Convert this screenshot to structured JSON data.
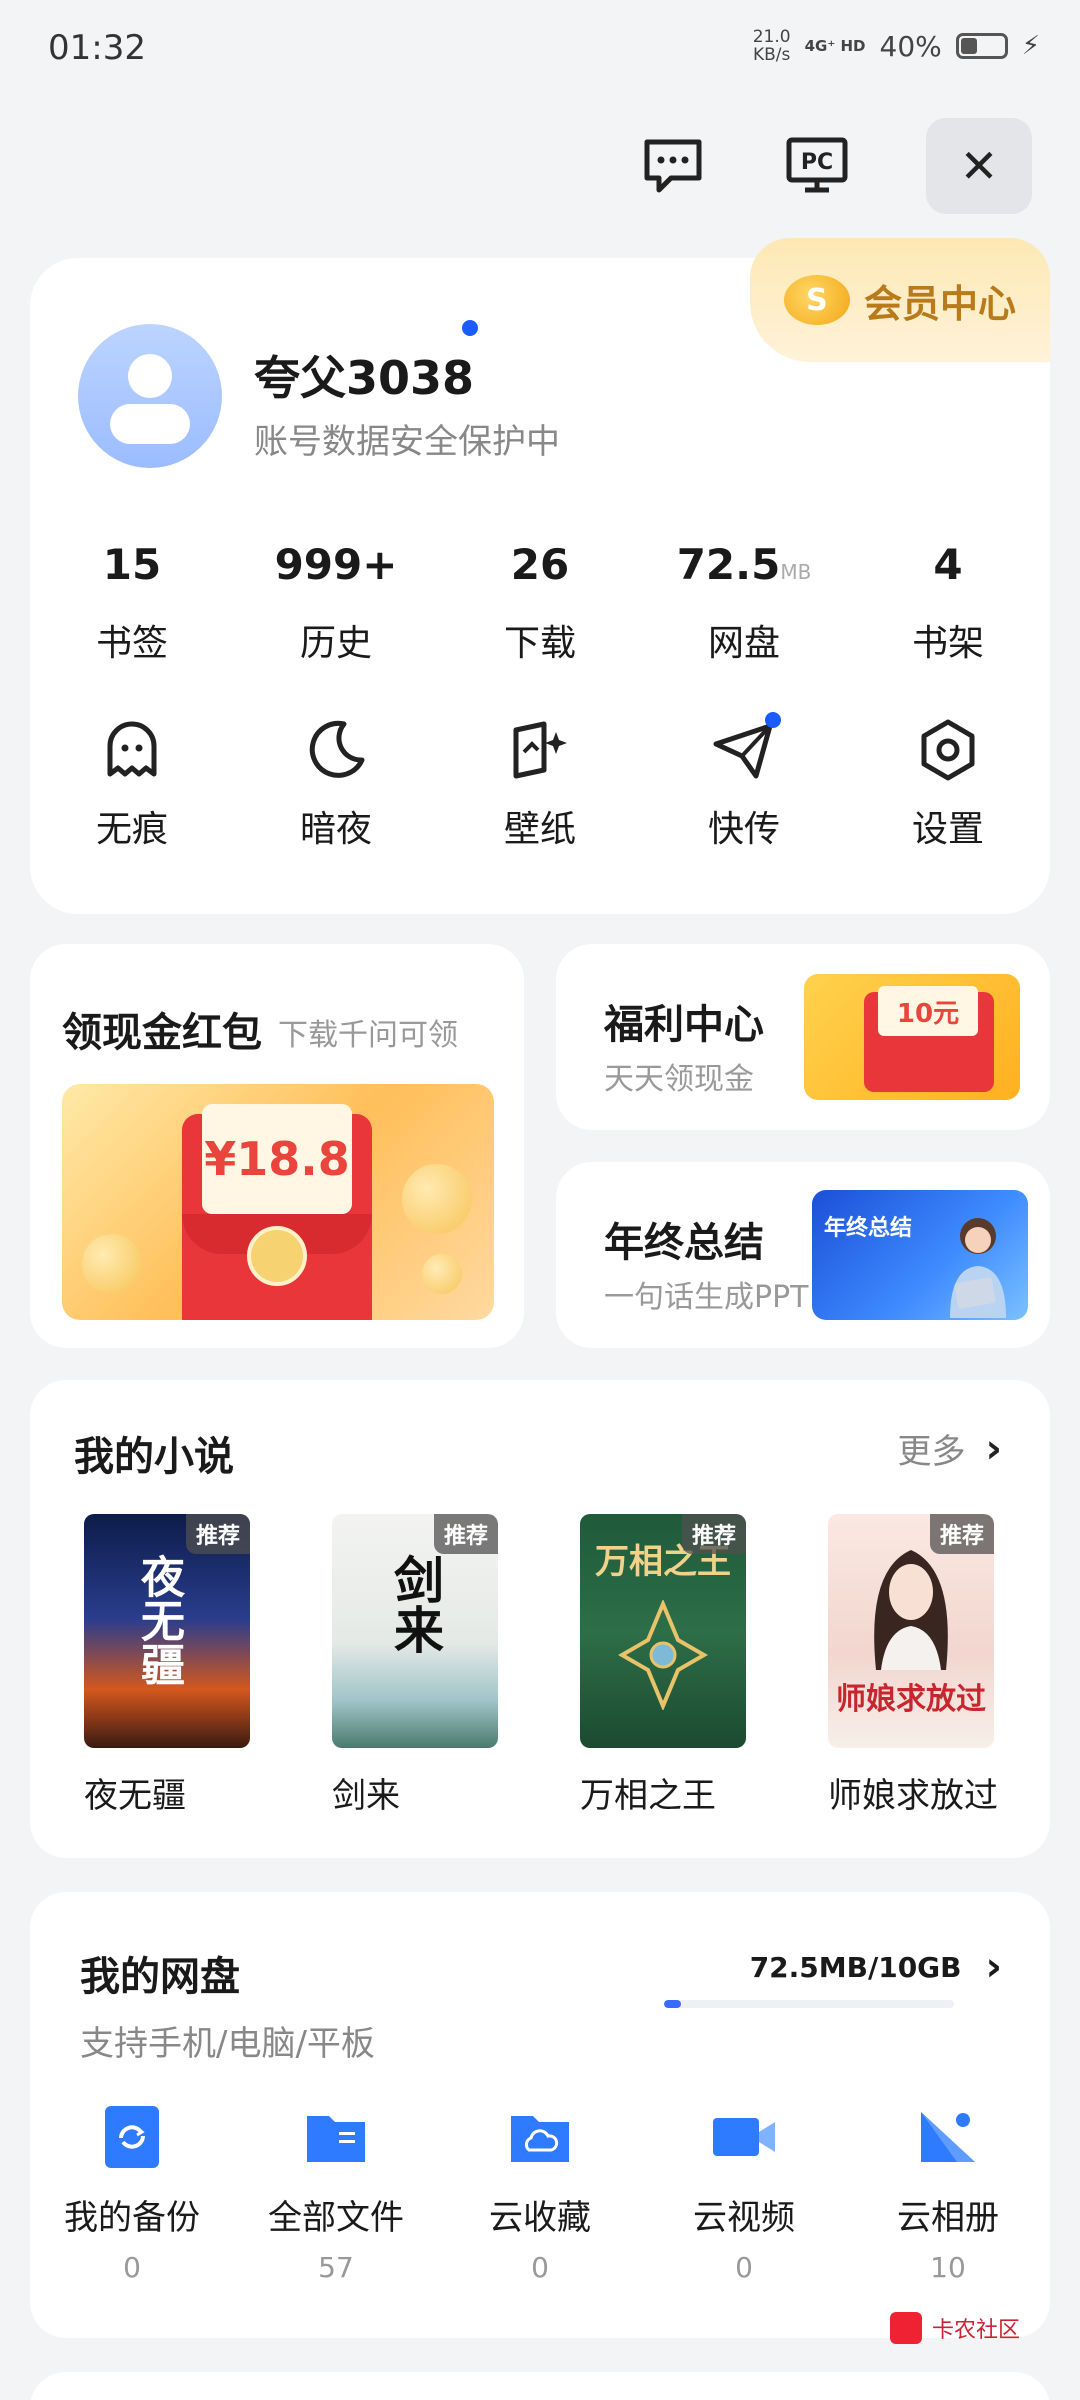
{
  "status_bar": {
    "time": "01:32",
    "net_speed": "21.0",
    "net_unit": "KB/s",
    "net_type": "4G⁺ HD",
    "battery_pct": "40%"
  },
  "top_actions": {
    "message_icon": "message-icon",
    "pc_label": "PC",
    "close_icon": "close-icon"
  },
  "profile": {
    "vip_label": "会员中心",
    "vip_icon_letter": "S",
    "username": "夸父3038",
    "subtitle": "账号数据安全保护中",
    "stats": [
      {
        "value": "15",
        "unit": "",
        "label": "书签"
      },
      {
        "value": "999+",
        "unit": "",
        "label": "历史"
      },
      {
        "value": "26",
        "unit": "",
        "label": "下载"
      },
      {
        "value": "72.5",
        "unit": "MB",
        "label": "网盘"
      },
      {
        "value": "4",
        "unit": "",
        "label": "书架"
      }
    ],
    "tools": [
      {
        "label": "无痕",
        "icon": "ghost-icon"
      },
      {
        "label": "暗夜",
        "icon": "moon-icon"
      },
      {
        "label": "壁纸",
        "icon": "wallpaper-icon"
      },
      {
        "label": "快传",
        "icon": "paper-plane-icon"
      },
      {
        "label": "设置",
        "icon": "settings-icon"
      }
    ]
  },
  "promos": {
    "red_packet": {
      "title": "领现金红包",
      "subtitle": "下载千问可领",
      "amount": "¥18.8"
    },
    "welfare": {
      "title": "福利中心",
      "subtitle": "天天领现金",
      "amount": "10元"
    },
    "year_summary": {
      "title": "年终总结",
      "subtitle": "一句话生成PPT",
      "image_text": "年终总结"
    }
  },
  "novels": {
    "title": "我的小说",
    "more": "更多",
    "badge": "推荐",
    "books": [
      {
        "name": "夜无疆",
        "cover_text": "夜无疆"
      },
      {
        "name": "剑来",
        "cover_text": "剑来"
      },
      {
        "name": "万相之王",
        "cover_text": "万相之王"
      },
      {
        "name": "师娘求放过",
        "cover_text": "师娘求放过"
      }
    ]
  },
  "netdisk": {
    "title": "我的网盘",
    "subtitle": "支持手机/电脑/平板",
    "usage": "72.5MB/10GB",
    "usage_fraction": 0.007,
    "items": [
      {
        "label": "我的备份",
        "count": "0"
      },
      {
        "label": "全部文件",
        "count": "57"
      },
      {
        "label": "云收藏",
        "count": "0"
      },
      {
        "label": "云视频",
        "count": "0"
      },
      {
        "label": "云相册",
        "count": "10"
      }
    ]
  },
  "watermark": "卡农社区",
  "colors": {
    "accent": "#1a5cff",
    "vip_gold": "#b87a1a",
    "disk_blue": "#2f7bff"
  }
}
